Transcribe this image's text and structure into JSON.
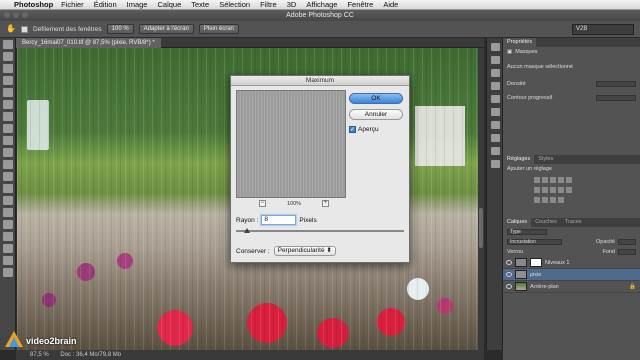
{
  "menubar": {
    "app": "Photoshop",
    "items": [
      "Fichier",
      "Édition",
      "Image",
      "Calque",
      "Texte",
      "Sélection",
      "Filtre",
      "3D",
      "Affichage",
      "Fenêtre",
      "Aide"
    ]
  },
  "window": {
    "title": "Adobe Photoshop CC"
  },
  "options": {
    "scroll_all_label": "Défilement des fenêtres",
    "zoom_100": "100 %",
    "fit_screen": "Adapter à l'écran",
    "fill_screen": "Plein écran",
    "workspace": "V2B"
  },
  "document": {
    "tab_label": "Bercy_16mai07_010.tif @ 87,5% (pixie, RVB/8*) *",
    "status_zoom": "87,5 %",
    "status_doc": "Doc : 36,4 Mo/79,8 Mo"
  },
  "brand": {
    "name": "video2brain"
  },
  "dialog": {
    "title": "Maximum",
    "ok": "OK",
    "cancel": "Annuler",
    "preview_label": "Aperçu",
    "preview_checked": true,
    "zoom": "100%",
    "radius_label": "Rayon :",
    "radius_value": "8",
    "radius_unit": "Pixels",
    "preserve_label": "Conserver :",
    "preserve_value": "Perpendicularité"
  },
  "properties": {
    "tabs": [
      "Propriétés"
    ],
    "masks_label": "Masques",
    "mask_status": "Aucun masque sélectionné",
    "density": "Densité",
    "feather": "Contour progressif"
  },
  "adjustments": {
    "tabs": [
      "Réglages",
      "Styles"
    ],
    "add_label": "Ajouter un réglage"
  },
  "layers": {
    "tabs": [
      "Calques",
      "Couches",
      "Tracés"
    ],
    "kind": "Type",
    "blend": "Incrustation",
    "opacity_label": "Opacité",
    "lock_label": "Verrou",
    "fill_label": "Fond",
    "items": [
      {
        "name": "Niveaux 1"
      },
      {
        "name": "pixie"
      },
      {
        "name": "Arrière-plan"
      }
    ]
  },
  "colors": {
    "accent": "#3a86d8",
    "selected_layer": "#4e6a8c"
  }
}
